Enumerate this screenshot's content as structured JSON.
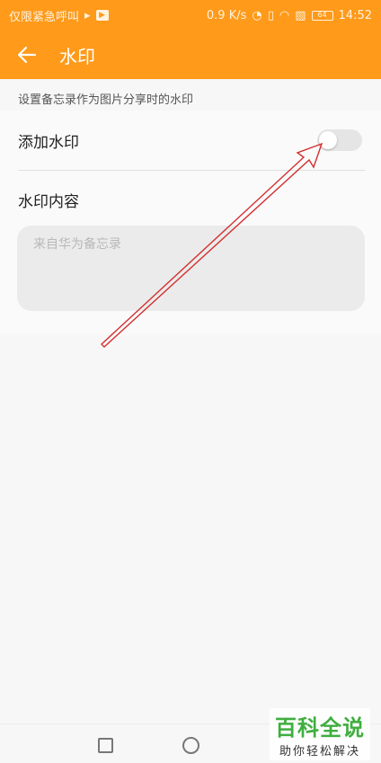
{
  "status_bar": {
    "left_text": "仅限紧急呼叫",
    "network_speed": "0.9 K/s",
    "battery": "64",
    "time": "14:52"
  },
  "app_bar": {
    "back_icon": "arrow-left-icon",
    "title": "水印"
  },
  "section_hint": "设置备忘录作为图片分享时的水印",
  "watermark_row": {
    "label": "添加水印",
    "enabled": false
  },
  "content": {
    "label": "水印内容",
    "placeholder": "来自华为备忘录",
    "value": ""
  },
  "colors": {
    "accent": "#ff9a1a",
    "annotation_arrow": "#d32f2f"
  },
  "site_watermark": {
    "title": "百科全说",
    "subtitle": "助你轻松解决"
  }
}
